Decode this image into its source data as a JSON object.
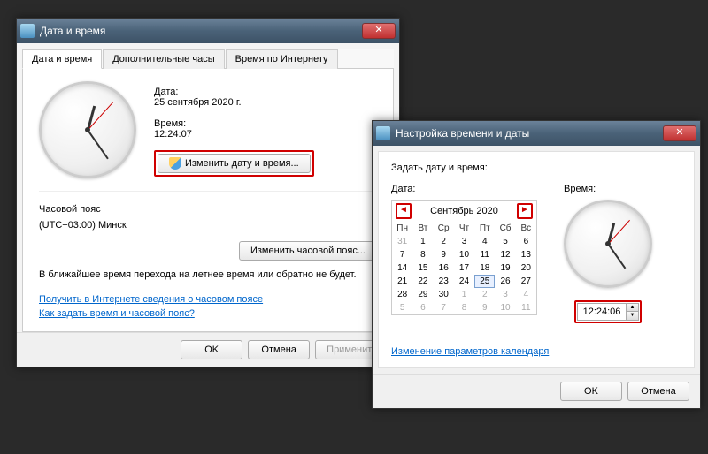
{
  "dialog1": {
    "title": "Дата и время",
    "tabs": [
      "Дата и время",
      "Дополнительные часы",
      "Время по Интернету"
    ],
    "date_label": "Дата:",
    "date_value": "25 сентября 2020 г.",
    "time_label": "Время:",
    "time_value": "12:24:07",
    "change_dt_btn": "Изменить дату и время...",
    "tz_header": "Часовой пояс",
    "tz_value": "(UTC+03:00) Минск",
    "change_tz_btn": "Изменить часовой пояс...",
    "dst_text": "В ближайшее время перехода на летнее время или обратно не будет.",
    "link1": "Получить в Интернете сведения о часовом поясе",
    "link2": "Как задать время и часовой пояс?",
    "ok": "OK",
    "cancel": "Отмена",
    "apply": "Применить"
  },
  "dialog2": {
    "title": "Настройка времени и даты",
    "header": "Задать дату и время:",
    "date_label": "Дата:",
    "time_label": "Время:",
    "cal_title": "Сентябрь 2020",
    "dow": [
      "Пн",
      "Вт",
      "Ср",
      "Чт",
      "Пт",
      "Сб",
      "Вс"
    ],
    "days": [
      {
        "n": 31,
        "o": true
      },
      {
        "n": 1
      },
      {
        "n": 2
      },
      {
        "n": 3
      },
      {
        "n": 4
      },
      {
        "n": 5
      },
      {
        "n": 6
      },
      {
        "n": 7
      },
      {
        "n": 8
      },
      {
        "n": 9
      },
      {
        "n": 10
      },
      {
        "n": 11
      },
      {
        "n": 12
      },
      {
        "n": 13
      },
      {
        "n": 14
      },
      {
        "n": 15
      },
      {
        "n": 16
      },
      {
        "n": 17
      },
      {
        "n": 18
      },
      {
        "n": 19
      },
      {
        "n": 20
      },
      {
        "n": 21
      },
      {
        "n": 22
      },
      {
        "n": 23
      },
      {
        "n": 24
      },
      {
        "n": 25,
        "s": true
      },
      {
        "n": 26
      },
      {
        "n": 27
      },
      {
        "n": 28
      },
      {
        "n": 29
      },
      {
        "n": 30
      },
      {
        "n": 1,
        "o": true
      },
      {
        "n": 2,
        "o": true
      },
      {
        "n": 3,
        "o": true
      },
      {
        "n": 4,
        "o": true
      },
      {
        "n": 5,
        "o": true
      },
      {
        "n": 6,
        "o": true
      },
      {
        "n": 7,
        "o": true
      },
      {
        "n": 8,
        "o": true
      },
      {
        "n": 9,
        "o": true
      },
      {
        "n": 10,
        "o": true
      },
      {
        "n": 11,
        "o": true
      }
    ],
    "time_value": "12:24:06",
    "link": "Изменение параметров календаря",
    "ok": "OK",
    "cancel": "Отмена"
  }
}
